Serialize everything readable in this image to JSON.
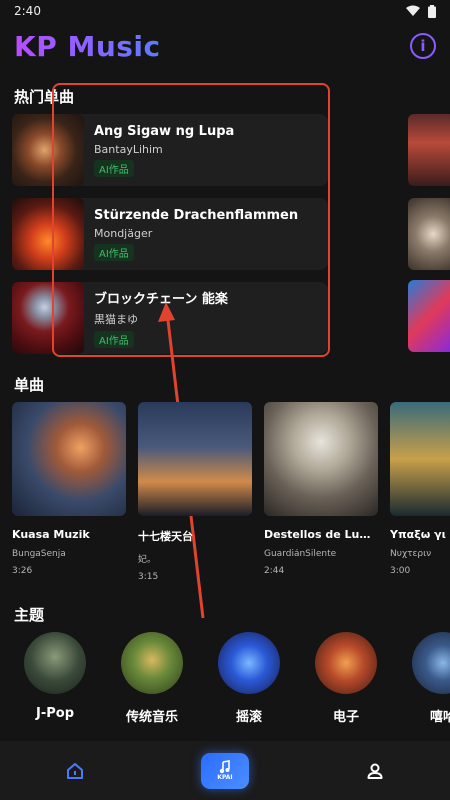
{
  "status_bar": {
    "time": "2:40"
  },
  "header": {
    "title": "KP Music"
  },
  "hot_singles": {
    "title": "热门单曲",
    "items": [
      {
        "title": "Ang Sigaw ng Lupa",
        "artist": "BantayLihim",
        "badge": "AI作品"
      },
      {
        "title": "Stürzende Drachenflammen",
        "artist": "Mondjäger",
        "badge": "AI作品"
      },
      {
        "title": "ブロックチェーン 能楽",
        "artist": "黒猫まゆ",
        "badge": "AI作品"
      }
    ]
  },
  "singles": {
    "title": "单曲",
    "items": [
      {
        "title": "Kuasa Muzik",
        "artist": "BungaSenja",
        "duration": "3:26"
      },
      {
        "title": "十七楼天台",
        "artist": "妃。",
        "duration": "3:15"
      },
      {
        "title": "Destellos de Luna ...",
        "artist": "GuardiánSilente",
        "duration": "2:44"
      },
      {
        "title": "Υπαξω γι",
        "artist": "Νυχτεριν",
        "duration": "3:00"
      }
    ]
  },
  "themes": {
    "title": "主题",
    "items": [
      {
        "label": "J-Pop"
      },
      {
        "label": "传统音乐"
      },
      {
        "label": "摇滚"
      },
      {
        "label": "电子"
      },
      {
        "label": "嘻哈"
      }
    ]
  },
  "bottom_nav": {
    "center_label": "KPAI"
  }
}
